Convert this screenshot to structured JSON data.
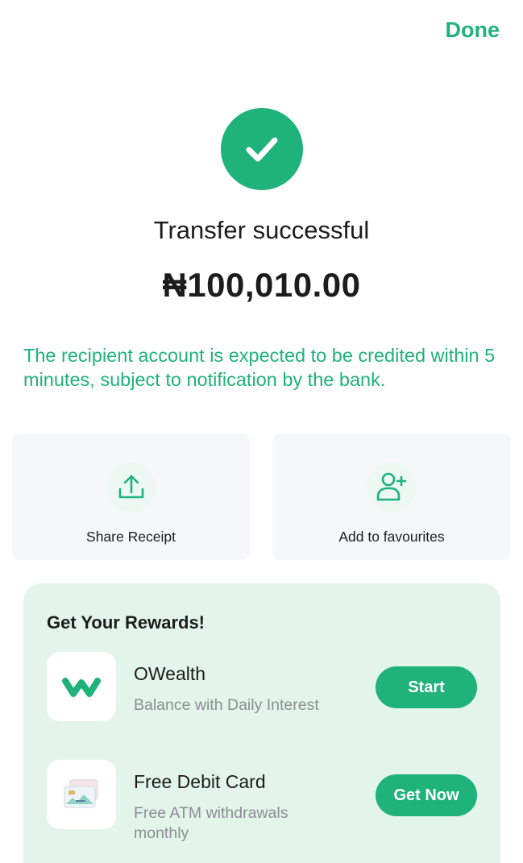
{
  "header": {
    "done_label": "Done"
  },
  "status": {
    "title": "Transfer successful",
    "amount": "₦100,010.00",
    "notice": "The recipient account is expected to be credited within 5 minutes, subject to notification by the bank."
  },
  "actions": [
    {
      "label": "Share Receipt",
      "icon": "upload-share-icon"
    },
    {
      "label": "Add to favourites",
      "icon": "add-user-icon"
    }
  ],
  "rewards": {
    "title": "Get Your Rewards!",
    "items": [
      {
        "name": "OWealth",
        "description": "Balance with Daily Interest",
        "button_label": "Start",
        "icon": "owealth-logo-icon"
      },
      {
        "name": "Free Debit Card",
        "description": "Free ATM withdrawals monthly",
        "button_label": "Get Now",
        "icon": "debit-card-icon"
      }
    ]
  },
  "colors": {
    "accent": "#1fb27a",
    "rewards_bg": "#e3f5eb",
    "card_bg": "#f6f7f8",
    "muted_text": "#8a8e93"
  }
}
